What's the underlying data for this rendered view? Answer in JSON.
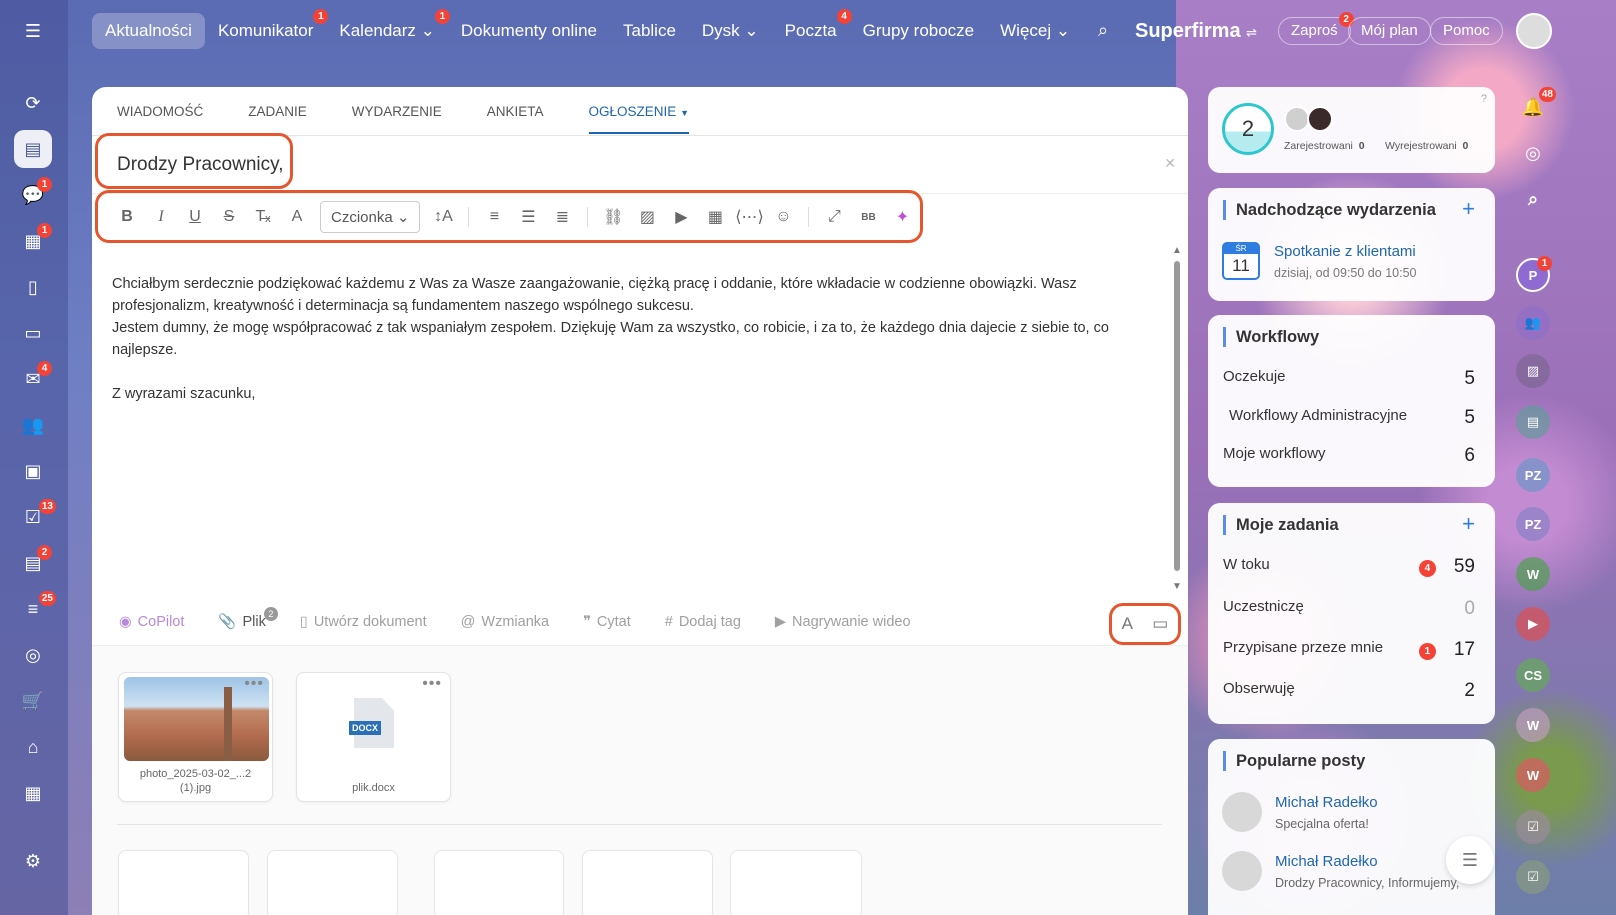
{
  "top_nav": {
    "items": [
      {
        "label": "Aktualności",
        "badge": ""
      },
      {
        "label": "Komunikator",
        "badge": "1"
      },
      {
        "label": "Kalendarz ⌄",
        "badge": "1"
      },
      {
        "label": "Dokumenty online",
        "badge": ""
      },
      {
        "label": "Tablice",
        "badge": ""
      },
      {
        "label": "Dysk ⌄",
        "badge": ""
      },
      {
        "label": "Poczta",
        "badge": "4"
      },
      {
        "label": "Grupy robocze",
        "badge": ""
      },
      {
        "label": "Więcej ⌄",
        "badge": ""
      }
    ],
    "brand": "Superfirma",
    "invite": "Zaproś",
    "invite_badge": "2",
    "plan": "Mój plan",
    "help": "Pomoc"
  },
  "left_sidebar": {
    "badges": {
      "chat": "1",
      "calendar": "1",
      "mail": "4",
      "tasks": "13",
      "crm": "2",
      "feed": "25"
    }
  },
  "editor": {
    "tabs": [
      "Wiadomość",
      "Zadanie",
      "Wydarzenie",
      "Ankieta",
      "Ogłoszenie"
    ],
    "active_tab": "Ogłoszenie",
    "title": "Drodzy Pracownicy,",
    "font_select": "Czcionka",
    "body": [
      "Chciałbym serdecznie podziękować każdemu z Was za Wasze zaangażowanie, ciężką pracę i oddanie, które wkładacie w codzienne obowiązki. Wasz profesjonalizm, kreatywność i determinacja są fundamentem naszego wspólnego sukcesu.",
      "Jestem dumny, że mogę współpracować z tak wspaniałym zespołem. Dziękuję Wam za wszystko, co robicie, i za to, że każdego dnia dajecie z siebie to, co najlepsze.",
      "Z wyrazami szacunku,"
    ],
    "actions": {
      "copilot": "CoPilot",
      "file": "Plik",
      "file_count": "2",
      "create_doc": "Utwórz dokument",
      "mention": "Wzmianka",
      "quote": "Cytat",
      "tag": "Dodaj tag",
      "video": "Nagrywanie wideo"
    },
    "attachments": [
      {
        "name_line1": "photo_2025-03-02_...2",
        "name_line2": "(1).jpg"
      },
      {
        "name": "plik.docx",
        "type_label": "DOCX"
      }
    ]
  },
  "right_panel": {
    "online": {
      "count": "2",
      "registered_label": "Zarejestrowani",
      "registered": "0",
      "unregistered_label": "Wyrejestrowani",
      "unregistered": "0"
    },
    "events": {
      "title": "Nadchodzące wydarzenia",
      "cal_dow": "ŚR",
      "cal_day": "11",
      "event_name": "Spotkanie z klientami",
      "event_time": "dzisiaj, od 09:50 do 10:50"
    },
    "workflows": {
      "title": "Workflowy",
      "rows": [
        {
          "label": "Oczekuje",
          "value": "5"
        },
        {
          "label": "Workflowy Administracyjne",
          "value": "5"
        },
        {
          "label": "Moje workflowy",
          "value": "6"
        }
      ]
    },
    "tasks": {
      "title": "Moje zadania",
      "rows": [
        {
          "label": "W toku",
          "badge": "4",
          "value": "59"
        },
        {
          "label": "Uczestniczę",
          "badge": "",
          "value": "0"
        },
        {
          "label": "Przypisane przeze mnie",
          "badge": "1",
          "value": "17"
        },
        {
          "label": "Obserwuję",
          "badge": "",
          "value": "2"
        }
      ]
    },
    "posts": {
      "title": "Popularne posty",
      "items": [
        {
          "author": "Michał Radełko",
          "text": "Specjalna oferta!"
        },
        {
          "author": "Michał Radełko",
          "text": "Drodzy Pracownicy, Informujemy,"
        }
      ]
    }
  },
  "far_right": {
    "notifications": "48",
    "user_p_badge": "1",
    "avatars": [
      "P",
      "PZ",
      "PZ",
      "W",
      "CS",
      "W",
      "W"
    ]
  }
}
